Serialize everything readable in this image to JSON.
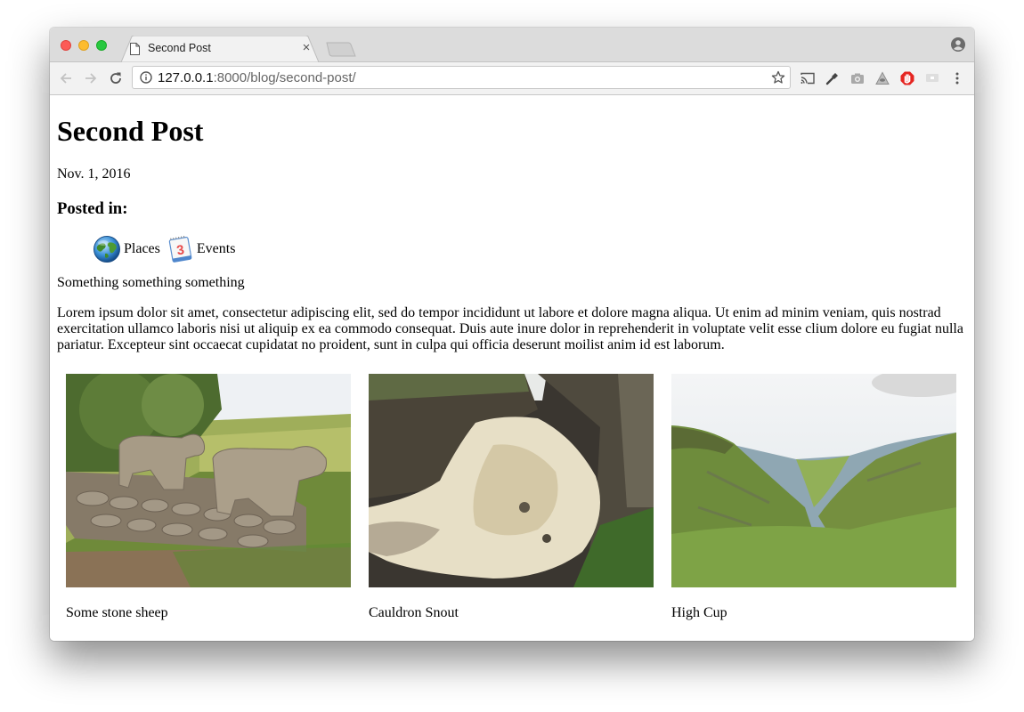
{
  "browser": {
    "tab": {
      "title": "Second Post",
      "close_glyph": "×"
    },
    "address_bar": {
      "host": "127.0.0.1",
      "rest": ":8000/blog/second-post/"
    },
    "icons": {
      "back": "back-arrow-icon",
      "forward": "forward-arrow-icon",
      "reload": "reload-icon",
      "info": "info-icon",
      "bookmark": "star-icon",
      "extensions": [
        "cast-icon",
        "wrench-icon",
        "camera-icon",
        "pyramid-eye-icon",
        "adblock-hand-icon",
        "screen-share-icon",
        "menu-kebab-icon"
      ],
      "profile": "profile-icon"
    },
    "colors": {
      "close": "#fc5b57",
      "minimize": "#fdbc2f",
      "zoom": "#28c840"
    }
  },
  "post": {
    "title": "Second Post",
    "date": "Nov. 1, 2016",
    "posted_in_label": "Posted in:",
    "categories": [
      {
        "label": "Places",
        "icon": "globe-icon"
      },
      {
        "label": "Events",
        "icon": "calendar-icon",
        "icon_text": "3"
      }
    ],
    "lead": "Something something something",
    "body": "Lorem ipsum dolor sit amet, consectetur adipiscing elit, sed do tempor incididunt ut labore et dolore magna aliqua. Ut enim ad minim veniam, quis nostrad exercitation ullamco laboris nisi ut aliquip ex ea commodo consequat. Duis aute inure dolor in reprehenderit in voluptate velit esse clium dolore eu fugiat nulla pariatur. Excepteur sint occaecat cupidatat no proident, sunt in culpa qui officia deserunt moilist anim id est laborum.",
    "gallery": [
      {
        "caption": "Some stone sheep",
        "image": "stone-sheep-photo"
      },
      {
        "caption": "Cauldron Snout",
        "image": "waterfall-photo"
      },
      {
        "caption": "High Cup",
        "image": "valley-photo"
      }
    ]
  }
}
